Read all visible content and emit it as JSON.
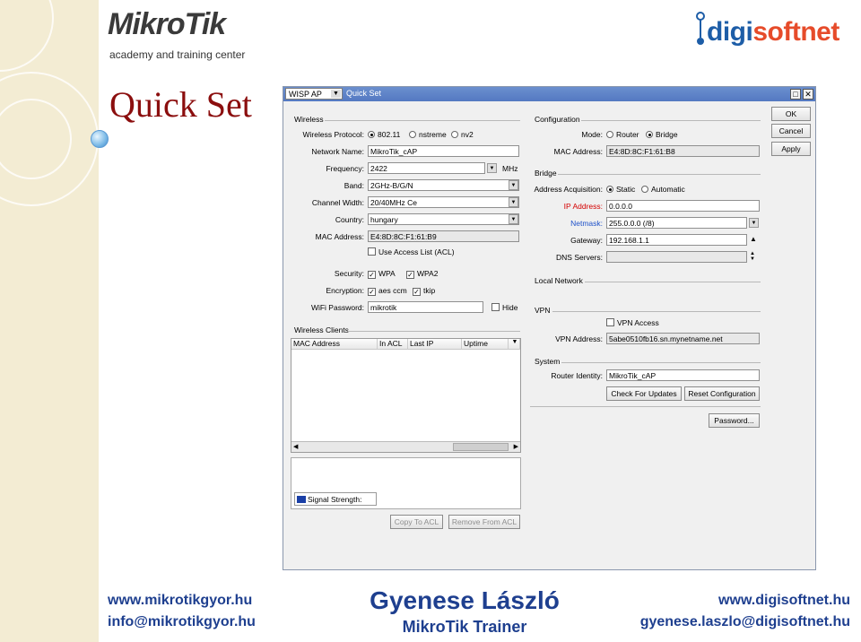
{
  "slide": {
    "title": "Quick Set",
    "mikrotik_logo": {
      "wordmark": "MikroTik",
      "subtitle": "academy and training center"
    },
    "digisoftnet_logo": {
      "wordmark_a": "digi",
      "wordmark_b": "softnet"
    },
    "footer": {
      "left_url": "www.mikrotikgyor.hu",
      "left_email": "info@mikrotikgyor.hu",
      "center_name": "Gyenese László",
      "center_role": "MikroTik Trainer",
      "right_url": "www.digisoftnet.hu",
      "right_email": "gyenese.laszlo@digisoftnet.hu"
    }
  },
  "window": {
    "mode_select": "WISP AP",
    "title": "Quick Set",
    "buttons": {
      "ok": "OK",
      "cancel": "Cancel",
      "apply": "Apply"
    },
    "wireless": {
      "section": "Wireless",
      "protocol_label": "Wireless Protocol:",
      "protocol_options": [
        "802.11",
        "nstreme",
        "nv2"
      ],
      "protocol_selected": "802.11",
      "network_name_label": "Network Name:",
      "network_name": "MikroTik_cAP",
      "frequency_label": "Frequency:",
      "frequency": "2422",
      "frequency_unit": "MHz",
      "band_label": "Band:",
      "band": "2GHz-B/G/N",
      "channel_width_label": "Channel Width:",
      "channel_width": "20/40MHz Ce",
      "country_label": "Country:",
      "country": "hungary",
      "mac_label": "MAC Address:",
      "mac": "E4:8D:8C:F1:61:B9",
      "acl_label": "Use Access List (ACL)",
      "security_label": "Security:",
      "wpa": "WPA",
      "wpa2": "WPA2",
      "encryption_label": "Encryption:",
      "aes": "aes ccm",
      "tkip": "tkip",
      "password_label": "WiFi Password:",
      "password": "mikrotik",
      "hide_label": "Hide"
    },
    "clients": {
      "section": "Wireless Clients",
      "columns": [
        "MAC Address",
        "In ACL",
        "Last IP",
        "Uptime"
      ],
      "signal_label": "Signal Strength:",
      "copy_btn": "Copy To ACL",
      "remove_btn": "Remove From ACL"
    },
    "configuration": {
      "section": "Configuration",
      "mode_label": "Mode:",
      "mode_options": [
        "Router",
        "Bridge"
      ],
      "mode_selected": "Bridge",
      "mac_label": "MAC Address:",
      "mac": "E4:8D:8C:F1:61:B8"
    },
    "bridge": {
      "section": "Bridge",
      "acq_label": "Address Acquisition:",
      "acq_options": [
        "Static",
        "Automatic"
      ],
      "acq_selected": "Static",
      "ip_label": "IP Address:",
      "ip": "0.0.0.0",
      "netmask_label": "Netmask:",
      "netmask": "255.0.0.0 (/8)",
      "gateway_label": "Gateway:",
      "gateway": "192.168.1.1",
      "dns_label": "DNS Servers:",
      "dns": ""
    },
    "local_network": {
      "section": "Local Network"
    },
    "vpn": {
      "section": "VPN",
      "access_label": "VPN Access",
      "address_label": "VPN Address:",
      "address": "5abe0510fb16.sn.mynetname.net"
    },
    "system": {
      "section": "System",
      "identity_label": "Router Identity:",
      "identity": "MikroTik_cAP",
      "check_updates": "Check For Updates",
      "reset_config": "Reset Configuration",
      "password_btn": "Password..."
    },
    "colors": {
      "accent_label": "#d40000",
      "netmask_label": "#1f52c9",
      "titlebar": "#5f84c8"
    }
  }
}
